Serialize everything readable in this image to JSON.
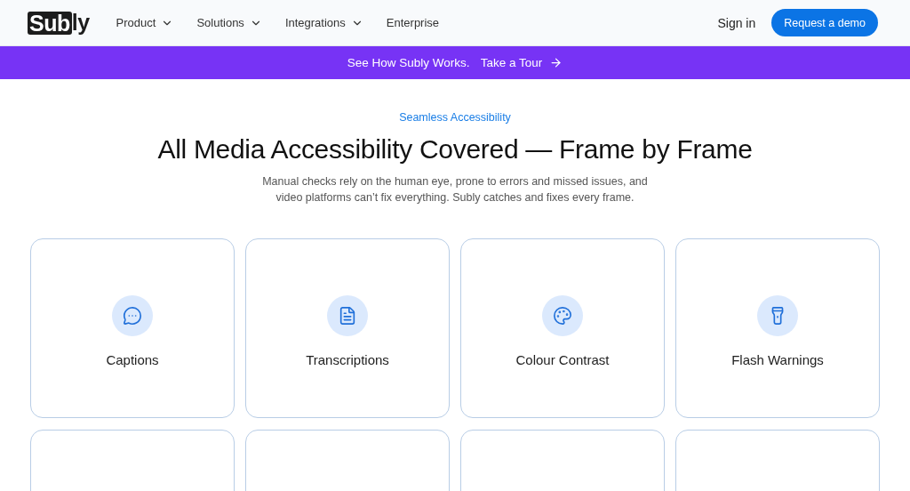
{
  "header": {
    "logo": {
      "boxed": "Sub",
      "rest": "ly"
    },
    "nav": [
      {
        "label": "Product",
        "dropdown": true
      },
      {
        "label": "Solutions",
        "dropdown": true
      },
      {
        "label": "Integrations",
        "dropdown": true
      },
      {
        "label": "Enterprise",
        "dropdown": false
      }
    ],
    "sign_in": "Sign in",
    "cta": "Request a demo"
  },
  "banner": {
    "text": "See How Subly Works.",
    "link": "Take a Tour"
  },
  "section": {
    "eyebrow": "Seamless Accessibility",
    "title": "All Media Accessibility Covered — Frame by Frame",
    "description": "Manual checks rely on the human eye, prone to errors and missed issues, and video platforms can’t fix everything. Subly catches and fixes every frame.",
    "cards": [
      {
        "kind": "full",
        "label": "Captions"
      },
      {
        "kind": "full",
        "label": "Transcriptions"
      },
      {
        "kind": "full",
        "label": "Colour Contrast"
      },
      {
        "kind": "full",
        "label": "Flash Warnings"
      },
      {
        "kind": "partial"
      },
      {
        "kind": "partial"
      },
      {
        "kind": "partial"
      },
      {
        "kind": "partial"
      }
    ]
  }
}
